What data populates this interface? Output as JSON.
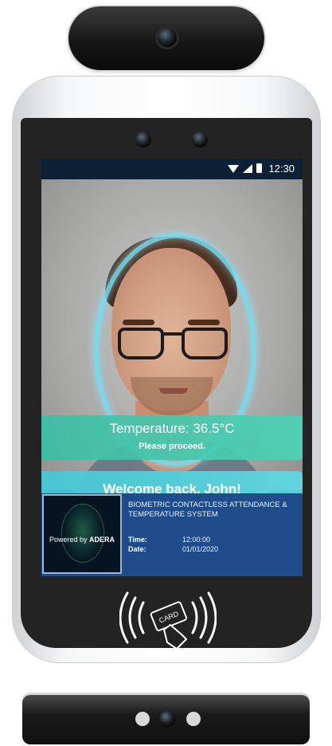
{
  "status_bar": {
    "time": "12:30",
    "icons": [
      "wifi-icon",
      "signal-icon",
      "battery-icon"
    ]
  },
  "camera_view": {
    "banners": {
      "temperature": "Temperature: 36.5°C",
      "instruction": "Please proceed.",
      "welcome": "Welcome back, John!"
    }
  },
  "info_panel": {
    "brand_prefix": "Powered by ",
    "brand_name": "ADERA",
    "system_title": "BIOMETRIC CONTACTLESS ATTENDANCE & TEMPERATURE SYSTEM",
    "time_label": "Time:",
    "time_value": "12:00:00",
    "date_label": "Date:",
    "date_value": "01/01/2020"
  },
  "nfc": {
    "card_text": "CARD",
    "icon": "nfc-card-reader-icon"
  },
  "colors": {
    "temperature_banner": "#3cbea5",
    "welcome_banner": "#46c8d7",
    "info_panel": "#1f4d8c",
    "face_outline": "#78dcf0"
  }
}
